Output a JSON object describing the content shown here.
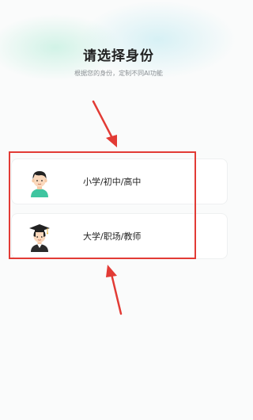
{
  "header": {
    "title": "请选择身份",
    "subtitle": "根据您的身份，定制不同AI功能"
  },
  "options": [
    {
      "label": "小学/初中/高中",
      "icon": "boy-student-icon"
    },
    {
      "label": "大学/职场/教师",
      "icon": "graduate-icon"
    }
  ],
  "annotation": {
    "color": "#e23b35"
  }
}
